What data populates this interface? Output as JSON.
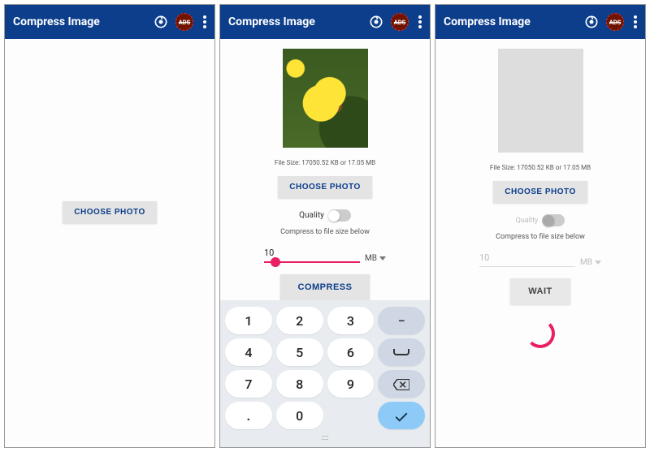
{
  "app_title": "Compress Image",
  "ads_label": "ADS",
  "file_size_caption": "File Size: 17050.52 KB or 17.05 MB",
  "buttons": {
    "choose_photo": "CHOOSE PHOTO",
    "compress": "COMPRESS",
    "wait": "WAIT"
  },
  "labels": {
    "quality": "Quality",
    "compress_to": "Compress to file size below"
  },
  "input": {
    "value": "10",
    "unit": "MB"
  },
  "keypad": {
    "keys": [
      "1",
      "2",
      "3",
      "−",
      "4",
      "5",
      "6",
      "␣",
      "7",
      "8",
      "9",
      "⌫",
      ".",
      "0",
      "",
      "✓"
    ]
  }
}
